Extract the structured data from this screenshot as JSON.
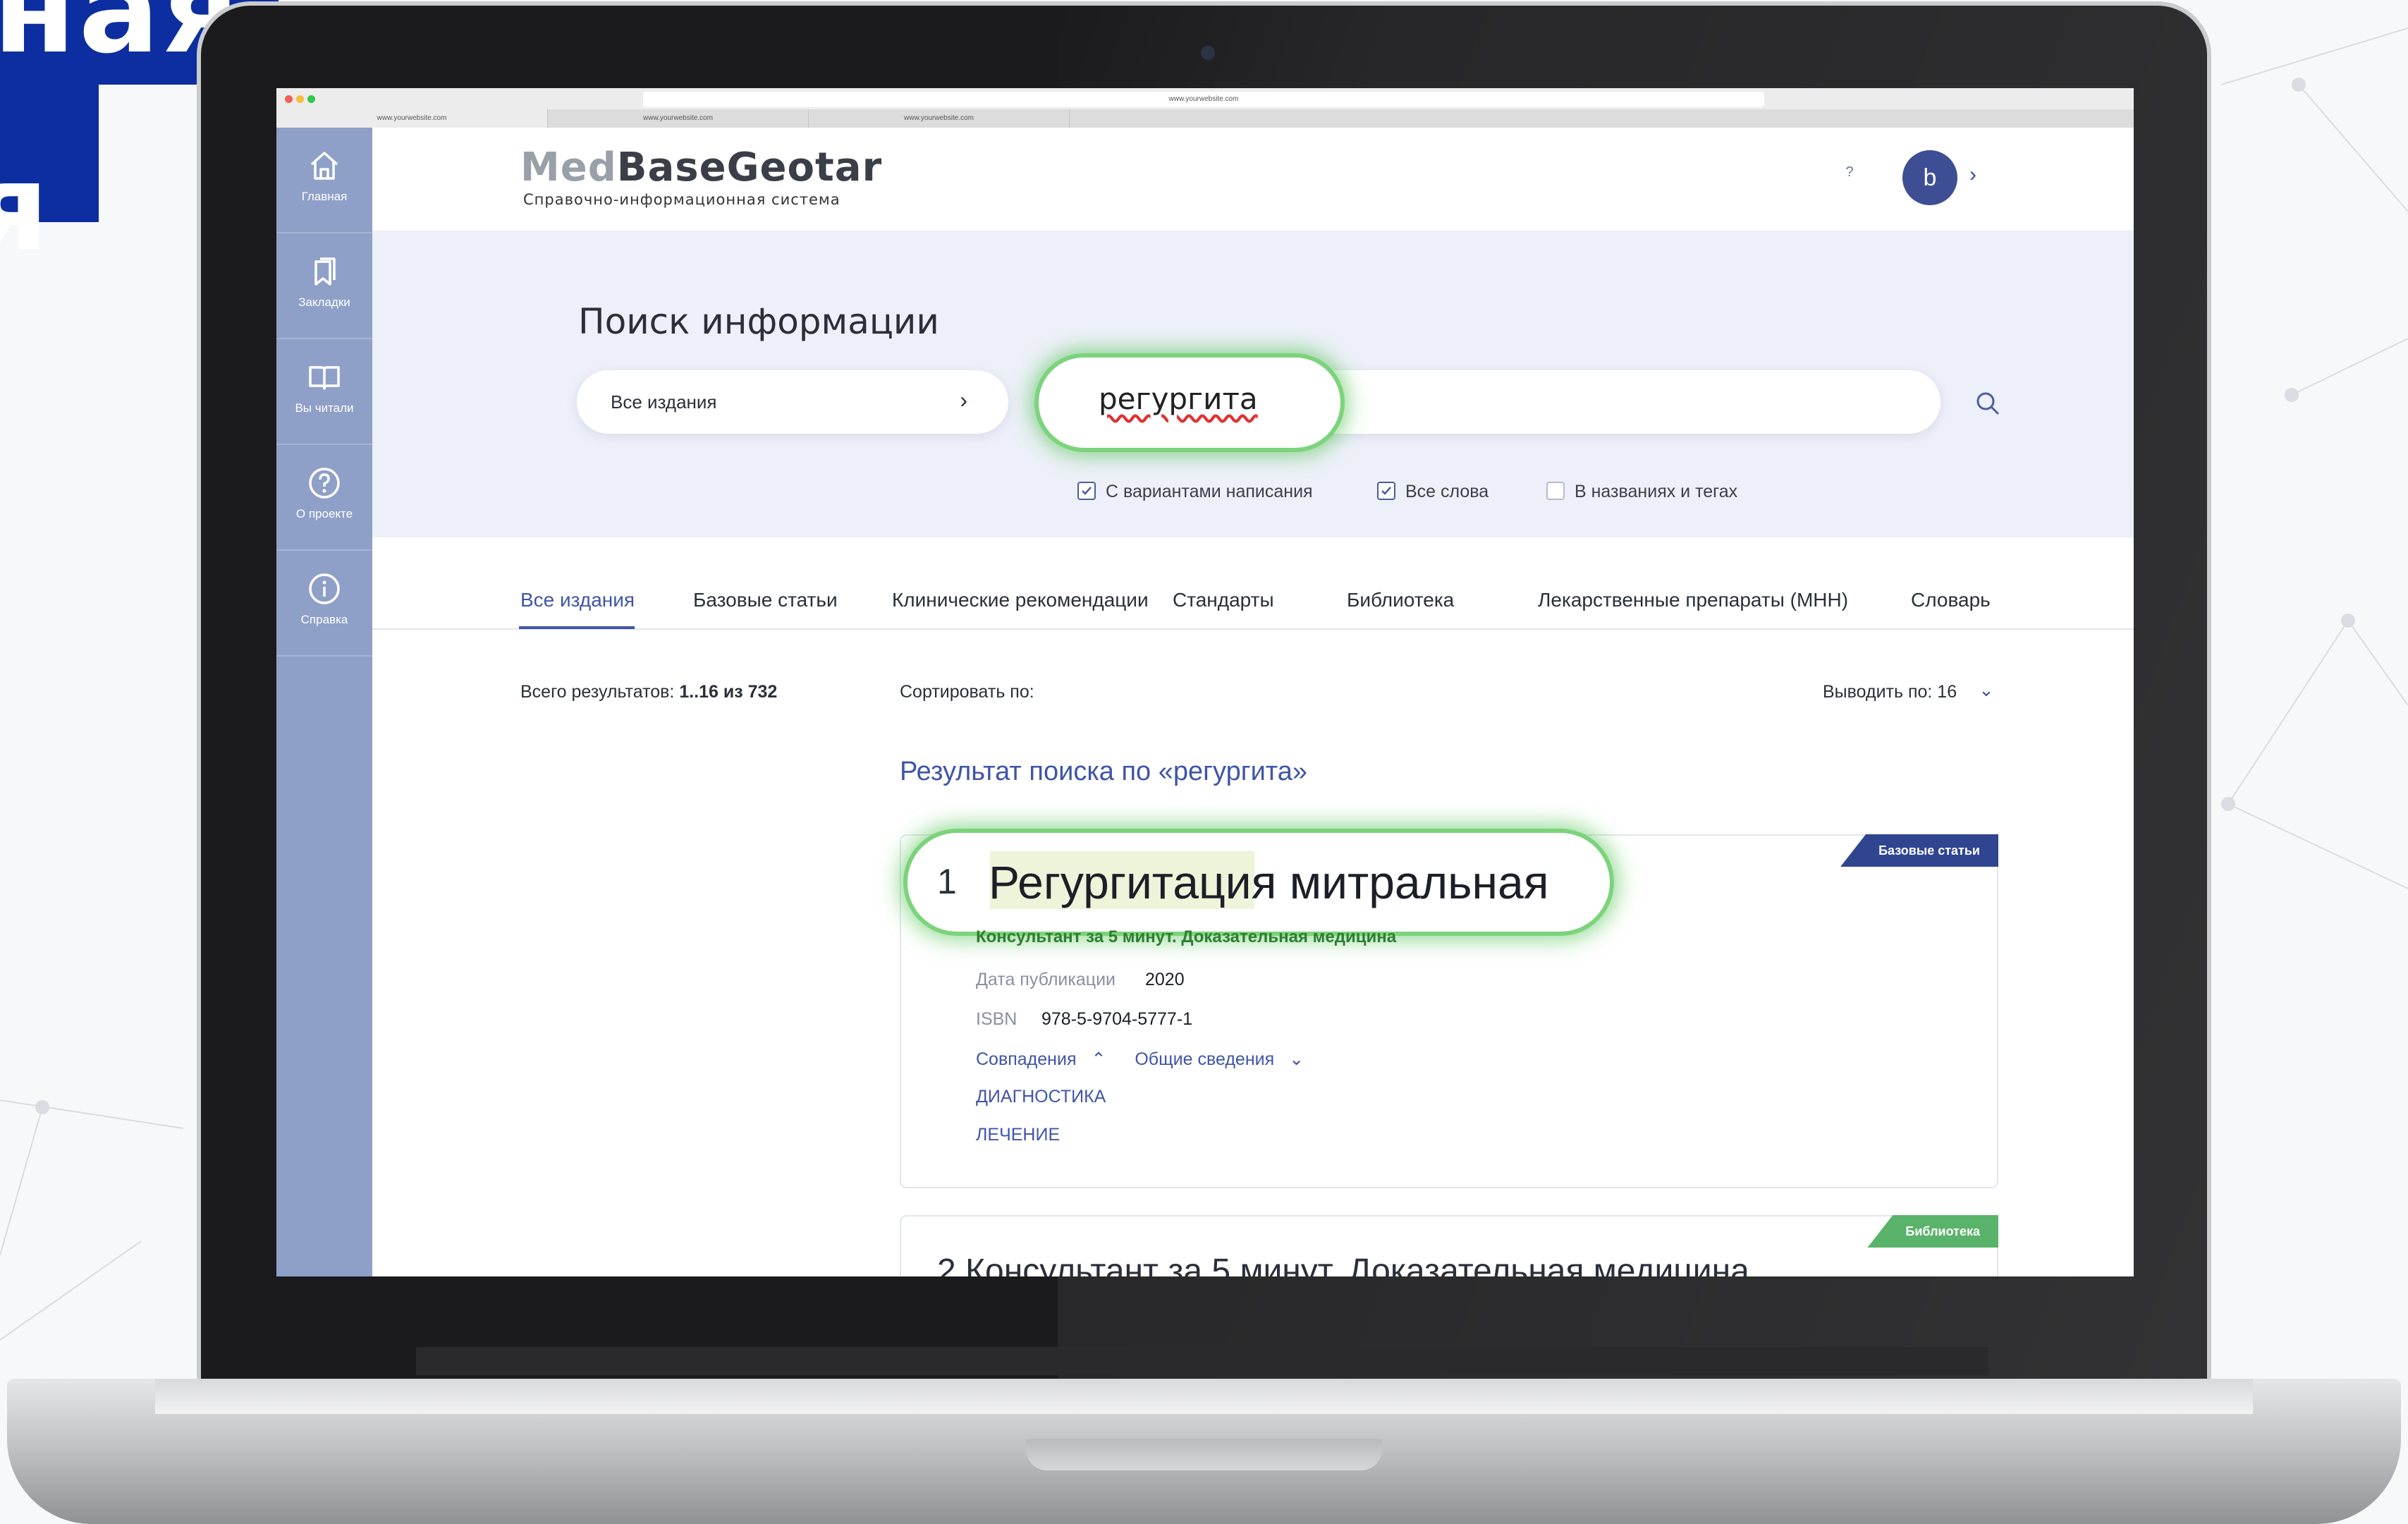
{
  "banner": {
    "line1": "ная",
    "line2": "я"
  },
  "browser": {
    "url": "www.yourwebsite.com",
    "tabs": [
      "www.yourwebsite.com",
      "www.yourwebsite.com",
      "www.yourwebsite.com"
    ]
  },
  "sidebar": {
    "items": [
      {
        "label": "Главная",
        "icon": "home-icon"
      },
      {
        "label": "Закладки",
        "icon": "bookmark-icon"
      },
      {
        "label": "Вы читали",
        "icon": "book-icon"
      },
      {
        "label": "О проекте",
        "icon": "question-circle-icon"
      },
      {
        "label": "Справка",
        "icon": "info-circle-icon"
      }
    ]
  },
  "header": {
    "logo_part1": "Med",
    "logo_part2": "Base",
    "logo_part3": "Geotar",
    "logo_subtitle": "Справочно-информационная система",
    "help": "?",
    "avatar_letter": "b"
  },
  "search": {
    "title": "Поиск информации",
    "editions_value": "Все издания",
    "query": "регургита",
    "options": [
      {
        "label": "С вариантами написания",
        "checked": true
      },
      {
        "label": "Все слова",
        "checked": true
      },
      {
        "label": "В названиях и тегах",
        "checked": false
      }
    ]
  },
  "tabs": [
    {
      "label": "Все издания",
      "active": true
    },
    {
      "label": "Базовые статьи"
    },
    {
      "label": "Клинические рекомендации"
    },
    {
      "label": "Стандарты"
    },
    {
      "label": "Библиотека"
    },
    {
      "label": "Лекарственные препараты (МНН)"
    },
    {
      "label": "Словарь"
    }
  ],
  "results": {
    "total_label": "Всего результатов: ",
    "total_value": "1..16 из 732",
    "sort_label": "Сортировать по:",
    "per_page_label": "Выводить по: 16",
    "heading": "Результат поиска по «регургита»"
  },
  "cards": [
    {
      "number": "1",
      "title_highlight": "Регургитация",
      "title_rest": " митральная",
      "badge": "Базовые статьи",
      "source": "Консультант за 5 минут. Доказательная медицина",
      "date_label": "Дата публикации",
      "date_value": "2020",
      "isbn_label": "ISBN",
      "isbn_value": "978-5-9704-5777-1",
      "matches_label": "Совпадения",
      "general_label": "Общие сведения",
      "sections": [
        "ДИАГНОСТИКА",
        "ЛЕЧЕНИЕ"
      ]
    },
    {
      "title": "2  Консультант за 5 минут. Доказательная медицина",
      "badge": "Библиотека"
    }
  ],
  "colors": {
    "accent": "#3f55a8",
    "sidebar": "#8fa0c8",
    "highlight": "#7cd37c",
    "badge_blue": "#2f4590",
    "badge_green": "#5ab36a"
  }
}
